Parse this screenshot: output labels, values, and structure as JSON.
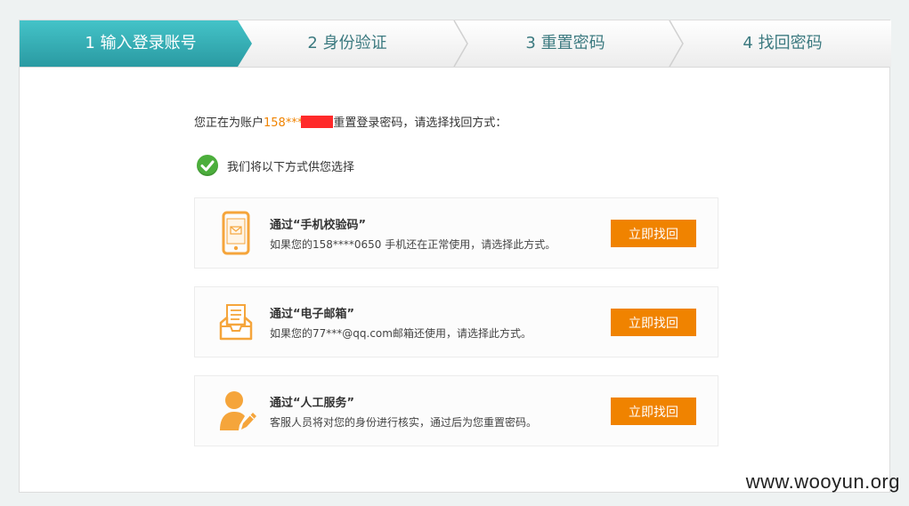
{
  "steps": [
    {
      "label": "1 输入登录账号",
      "active": true
    },
    {
      "label": "2 身份验证",
      "active": false
    },
    {
      "label": "3 重置密码",
      "active": false
    },
    {
      "label": "4 找回密码",
      "active": false
    }
  ],
  "intro": {
    "prefix": "您正在为账户",
    "account": "158***",
    "suffix": "重置登录密码，请选择找回方式："
  },
  "notice": "我们将以下方式供您选择",
  "options": [
    {
      "icon": "phone-icon",
      "title": "通过“手机校验码”",
      "desc": "如果您的158****0650 手机还在正常使用，请选择此方式。",
      "button": "立即找回"
    },
    {
      "icon": "mail-inbox-icon",
      "title": "通过“电子邮箱”",
      "desc": "如果您的77***@qq.com邮箱还使用，请选择此方式。",
      "button": "立即找回"
    },
    {
      "icon": "customer-service-icon",
      "title": "通过“人工服务”",
      "desc": "客服人员将对您的身份进行核实，通过后为您重置密码。",
      "button": "立即找回"
    }
  ],
  "watermark": "www.wooyun.org",
  "colors": {
    "accent": "#f08300",
    "step_active": "#3db4bb",
    "success": "#4cae3c"
  }
}
